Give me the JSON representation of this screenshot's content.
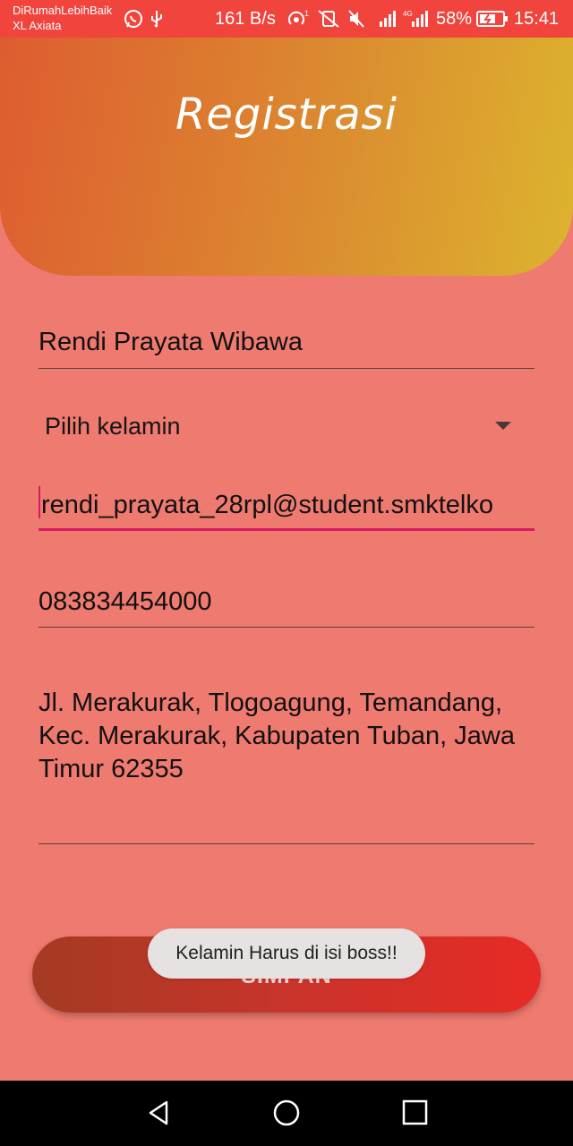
{
  "status_bar": {
    "carrier_line1": "DiRumahLebihBaik",
    "carrier_line2": "XL Axiata",
    "speed": "161 B/s",
    "battery": "58%",
    "time": "15:41"
  },
  "header": {
    "title": "Registrasi"
  },
  "form": {
    "name_value": "Rendi Prayata Wibawa",
    "gender_placeholder": "Pilih kelamin",
    "email_value": "rendi_prayata_28rpl@student.smktelko",
    "phone_value": "083834454000",
    "address_value": "Jl. Merakurak, Tlogoagung, Temandang, Kec. Merakurak, Kabupaten Tuban, Jawa Timur 62355"
  },
  "button": {
    "save_label": "SIMPAN"
  },
  "toast": {
    "message": "Kelamin Harus di isi boss!!"
  },
  "colors": {
    "background": "#ef7a70",
    "status_bar": "#f0443d",
    "header_start": "#de5c30",
    "header_end": "#dcb42e",
    "focus_accent": "#d81b60",
    "button_start": "#a53a22",
    "button_end": "#e72a25"
  },
  "icons": [
    "whatsapp-icon",
    "usb-icon",
    "hotspot-icon",
    "mute-icon",
    "signal-icon",
    "battery-icon",
    "back-icon",
    "home-icon",
    "recents-icon"
  ]
}
